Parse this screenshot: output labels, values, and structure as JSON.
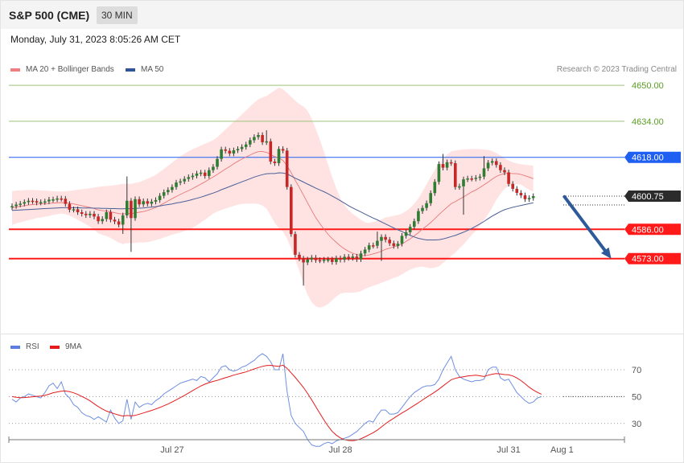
{
  "header": {
    "title": "S&P 500 (CME)",
    "timeframe": "30 MIN"
  },
  "date_text": "Monday, July 31, 2023 8:05:26 AM CET",
  "credit": "Research © 2023 Trading Central",
  "colors": {
    "bb_fill": "#ffd9d9",
    "ma20": "#e87878",
    "ma50": "#4a5f96",
    "bull": "#2e7d32",
    "bear": "#c62828",
    "resistance_green": "#9cc47a",
    "level_blue": "#1f5ff2",
    "level_red": "#ff1a1a",
    "rsi": "#6f8fe0",
    "rsi_ma": "#e51c1c",
    "arrow": "#2e5a9a"
  },
  "chart_data": [
    {
      "type": "candlestick",
      "legend": [
        {
          "name": "MA 20 + Bollinger Bands",
          "color": "#f08080"
        },
        {
          "name": "MA 50",
          "color": "#2f5597"
        }
      ],
      "ylim": [
        4551,
        4654
      ],
      "x_ticks": [
        {
          "label": "Jul 27",
          "i": 39
        },
        {
          "label": "Jul 28",
          "i": 80
        },
        {
          "label": "Jul 31",
          "i": 121
        },
        {
          "label": "Aug 1",
          "i": 134
        }
      ],
      "levels": [
        {
          "value": 4650.0,
          "label": "4650.00",
          "style": "green-text"
        },
        {
          "value": 4634.0,
          "label": "4634.00",
          "style": "green-text"
        },
        {
          "value": 4618.0,
          "label": "4618.00",
          "style": "blue-box"
        },
        {
          "value": 4600.75,
          "label": "4600.75",
          "style": "dark-box"
        },
        {
          "value": 4586.0,
          "label": "4586.00",
          "style": "red-box"
        },
        {
          "value": 4573.0,
          "label": "4573.00",
          "style": "red-box"
        }
      ],
      "close": [
        4596.3,
        4597,
        4597.4,
        4598.1,
        4598.7,
        4598.5,
        4597.9,
        4598.1,
        4598.4,
        4599.2,
        4599.3,
        4599.7,
        4599.6,
        4597.3,
        4594.7,
        4594.9,
        4593.6,
        4592.9,
        4592.3,
        4592.9,
        4591.7,
        4589.6,
        4590.6,
        4593.6,
        4590.3,
        4589.5,
        4588.1,
        4592.2,
        4598.7,
        4591,
        4599.4,
        4597.1,
        4598.5,
        4597.4,
        4598.3,
        4599,
        4600.9,
        4602.5,
        4603.5,
        4604.8,
        4606.8,
        4607.3,
        4608.4,
        4609.2,
        4609.8,
        4610.8,
        4611.2,
        4609.7,
        4612.3,
        4613.8,
        4617.3,
        4621.5,
        4620.9,
        4619.7,
        4621.1,
        4621.7,
        4622.6,
        4623.7,
        4625.6,
        4627,
        4627.9,
        4624.7,
        4625.1,
        4616.1,
        4615.4,
        4621.7,
        4621,
        4604.8,
        4583.9,
        4574.7,
        4573,
        4571.3,
        4572.6,
        4573.4,
        4572.3,
        4572.2,
        4572.5,
        4572.6,
        4571.5,
        4573.1,
        4572.5,
        4573.8,
        4573.3,
        4573.9,
        4572.7,
        4575.3,
        4577,
        4578.9,
        4578.7,
        4580.9,
        4582.6,
        4581.4,
        4579.8,
        4578.6,
        4579.6,
        4583.1,
        4584.7,
        4587.1,
        4589.6,
        4594.1,
        4595.5,
        4597.6,
        4602.1,
        4607.1,
        4615,
        4613.4,
        4615.8,
        4615.4,
        4604.8,
        4605.1,
        4608.2,
        4608.6,
        4608.5,
        4608.9,
        4609.4,
        4613.1,
        4615.6,
        4616.3,
        4614.6,
        4612.3,
        4611.3,
        4606.2,
        4604,
        4602.2,
        4601.1,
        4599.4,
        4599.9,
        4600.75
      ],
      "open": [
        4595.8,
        4596.3,
        4597,
        4597.4,
        4598.1,
        4598.7,
        4598.5,
        4597.9,
        4598.1,
        4598.4,
        4599.2,
        4599.3,
        4599.7,
        4599.6,
        4597.3,
        4594.7,
        4594.9,
        4593.6,
        4592.9,
        4592.3,
        4592.9,
        4591.7,
        4589.6,
        4590.6,
        4593.6,
        4590.3,
        4589.5,
        4588.1,
        4592.2,
        4598.7,
        4591,
        4599.4,
        4597.1,
        4598.5,
        4597.4,
        4598.3,
        4599,
        4600.9,
        4602.5,
        4603.5,
        4604.8,
        4606.8,
        4607.3,
        4608.4,
        4609.2,
        4609.8,
        4610.8,
        4611.2,
        4609.7,
        4612.3,
        4613.8,
        4617.3,
        4621.5,
        4620.9,
        4619.7,
        4621.1,
        4621.7,
        4622.6,
        4623.7,
        4625.6,
        4627,
        4627.9,
        4624.7,
        4625.1,
        4616.1,
        4615.4,
        4621.7,
        4621,
        4604.8,
        4583.9,
        4574.7,
        4573,
        4571.3,
        4572.6,
        4573.4,
        4572.3,
        4572.2,
        4572.5,
        4572.6,
        4571.5,
        4573.1,
        4572.5,
        4573.8,
        4573.3,
        4573.9,
        4572.7,
        4575.3,
        4577,
        4578.9,
        4578.7,
        4580.9,
        4582.6,
        4581.4,
        4579.8,
        4578.6,
        4579.6,
        4583.1,
        4584.7,
        4587.1,
        4589.6,
        4594.1,
        4595.5,
        4597.6,
        4602.1,
        4607.1,
        4615,
        4613.4,
        4615.8,
        4615.4,
        4604.8,
        4605.1,
        4608.2,
        4608.6,
        4608.5,
        4608.9,
        4609.4,
        4613.1,
        4615.6,
        4616.3,
        4614.6,
        4612.3,
        4611.3,
        4606.2,
        4604,
        4602.2,
        4601.1,
        4599.4,
        4599.9
      ],
      "wick_extremes": [
        {
          "i": 27,
          "value": 4584.0
        },
        {
          "i": 29,
          "value": 4576.0
        },
        {
          "i": 28,
          "value": 4609.5
        },
        {
          "i": 62,
          "value": 4630.0
        },
        {
          "i": 71,
          "value": 4561.0
        },
        {
          "i": 90,
          "value": 4572.0
        },
        {
          "i": 89,
          "value": 4585.0
        },
        {
          "i": 110,
          "value": 4592.5
        },
        {
          "i": 105,
          "value": 4619.5
        },
        {
          "i": 115,
          "value": 4618.5
        }
      ],
      "ma20": [
        4595.5,
        4595.9,
        4596.2,
        4596.5,
        4596.8,
        4597,
        4597.2,
        4597.3,
        4597.4,
        4597.5,
        4597.7,
        4597.8,
        4597.9,
        4597.8,
        4597.6,
        4597.3,
        4596.9,
        4596.5,
        4596.1,
        4595.7,
        4595.2,
        4594.6,
        4594.3,
        4594.1,
        4593.8,
        4593.4,
        4593,
        4592.8,
        4593.1,
        4593,
        4593.3,
        4593.6,
        4593.9,
        4594.4,
        4595,
        4595.7,
        4596.6,
        4597.6,
        4598.6,
        4599.6,
        4600.6,
        4601.5,
        4602.4,
        4603.2,
        4604.1,
        4605.1,
        4606.1,
        4607.1,
        4608.2,
        4609.3,
        4610.4,
        4611.6,
        4612.8,
        4613.9,
        4615.1,
        4616.2,
        4617.2,
        4618.1,
        4619,
        4619.9,
        4620.5,
        4620.6,
        4620.2,
        4619.3,
        4618.3,
        4617.8,
        4616.6,
        4614.3,
        4611.2,
        4607.8,
        4604.6,
        4601.2,
        4597.8,
        4594.4,
        4591.2,
        4588.5,
        4586.1,
        4583.8,
        4581.9,
        4580.2,
        4578.6,
        4577.3,
        4576.2,
        4575.4,
        4574.8,
        4574.4,
        4574.3,
        4574.6,
        4575.1,
        4575.6,
        4576.3,
        4577.1,
        4577.6,
        4578.2,
        4578.7,
        4579.5,
        4580.6,
        4581.8,
        4583.1,
        4584.5,
        4586.1,
        4587.5,
        4589,
        4590.7,
        4592.5,
        4594.2,
        4595.8,
        4597.4,
        4598.3,
        4599.4,
        4600.4,
        4601.5,
        4602.6,
        4603.5,
        4604.6,
        4605.8,
        4607,
        4608.3,
        4609.5,
        4610.3,
        4610.8,
        4610.9,
        4610.8,
        4610.7,
        4610.4,
        4609.8,
        4609.2,
        4608.5
      ],
      "bb_upper": [
        4603,
        4603.2,
        4603.3,
        4603.4,
        4603.5,
        4603.5,
        4603.4,
        4603.3,
        4603.2,
        4603.1,
        4603,
        4602.9,
        4602.8,
        4602.9,
        4603.1,
        4603.3,
        4603.6,
        4603.8,
        4604,
        4604.3,
        4604.6,
        4604.9,
        4605.1,
        4605.2,
        4605.4,
        4605.6,
        4605.9,
        4606.2,
        4606.3,
        4606.2,
        4606.6,
        4607,
        4607.7,
        4608.5,
        4609.3,
        4610.2,
        4611.5,
        4612.8,
        4614.2,
        4615.6,
        4617.1,
        4618.4,
        4619.6,
        4620.6,
        4621.6,
        4622.4,
        4623.2,
        4624,
        4624.8,
        4625.6,
        4626.9,
        4628.6,
        4630.4,
        4632,
        4633.8,
        4635.4,
        4637.1,
        4638.8,
        4640.6,
        4642.3,
        4643.8,
        4644.6,
        4645.2,
        4646.5,
        4647.7,
        4649,
        4648.2,
        4646.7,
        4644.9,
        4643.2,
        4641.6,
        4640.6,
        4638.7,
        4635.2,
        4630.6,
        4625.8,
        4620.5,
        4614.8,
        4609.3,
        4604.3,
        4599.8,
        4596.8,
        4594.5,
        4592.9,
        4591.6,
        4590.3,
        4589.1,
        4588.9,
        4589.3,
        4589.7,
        4590.4,
        4591.3,
        4591.6,
        4592,
        4592.4,
        4593,
        4594.1,
        4595.5,
        4597.4,
        4599.8,
        4602.8,
        4606,
        4609.3,
        4612.4,
        4615.4,
        4617.4,
        4619.2,
        4620.6,
        4621,
        4621.3,
        4621.5,
        4621.6,
        4621.7,
        4621.7,
        4621.6,
        4621.5,
        4621.3,
        4620.8,
        4619.9,
        4618.8,
        4617.6,
        4616.6,
        4615.8,
        4615.3,
        4614.9,
        4614.7,
        4614.5,
        4614.3
      ],
      "bb_lower": [
        4588,
        4588.6,
        4589.1,
        4589.6,
        4590.1,
        4590.5,
        4591,
        4591.3,
        4591.6,
        4591.9,
        4592.4,
        4592.7,
        4593,
        4592.7,
        4592.1,
        4591.3,
        4590.2,
        4589.2,
        4588.2,
        4587.1,
        4585.8,
        4584.3,
        4583.5,
        4583,
        4582.2,
        4581.2,
        4580.1,
        4579.4,
        4579.9,
        4579.8,
        4580,
        4580.2,
        4580.1,
        4580.3,
        4580.7,
        4581.2,
        4581.7,
        4582.4,
        4583,
        4583.6,
        4584.1,
        4584.6,
        4585.2,
        4585.8,
        4586.6,
        4587.8,
        4589,
        4590.2,
        4591.6,
        4593,
        4593.9,
        4594.6,
        4595.2,
        4595.8,
        4596.4,
        4597,
        4597.3,
        4597.4,
        4597.4,
        4597.5,
        4597.2,
        4596.6,
        4595.2,
        4592.1,
        4588.9,
        4586.6,
        4585,
        4581.9,
        4577.5,
        4572.4,
        4567.6,
        4561.8,
        4556.9,
        4553.6,
        4551.8,
        4551.2,
        4551.7,
        4552.8,
        4554.5,
        4556.1,
        4557.4,
        4557.8,
        4557.9,
        4557.9,
        4558,
        4558.5,
        4559.5,
        4560.3,
        4560.9,
        4561.5,
        4562.2,
        4562.9,
        4563.6,
        4564.4,
        4565,
        4566,
        4567.1,
        4568.1,
        4568.8,
        4569.2,
        4569.4,
        4569,
        4568.7,
        4569,
        4569.6,
        4571,
        4572.4,
        4574.2,
        4575.6,
        4577.5,
        4579.3,
        4581.4,
        4583.5,
        4585.3,
        4587.6,
        4590.1,
        4592.7,
        4595.8,
        4599.1,
        4601.8,
        4604,
        4605.2,
        4605.8,
        4606,
        4605.9,
        4604.7,
        4603.5,
        4602.7
      ],
      "ma50": [
        4594.4,
        4594.5,
        4594.6,
        4594.7,
        4594.8,
        4594.9,
        4595,
        4595.1,
        4595.2,
        4595.3,
        4595.4,
        4595.5,
        4595.6,
        4595.6,
        4595.6,
        4595.6,
        4595.6,
        4595.5,
        4595.5,
        4595.5,
        4595.4,
        4595.4,
        4595.3,
        4595.3,
        4595.2,
        4595.2,
        4595.1,
        4595.1,
        4595.2,
        4595.1,
        4595.3,
        4595.4,
        4595.5,
        4595.7,
        4595.9,
        4596.1,
        4596.4,
        4596.7,
        4597,
        4597.3,
        4597.7,
        4598,
        4598.4,
        4598.8,
        4599.3,
        4599.8,
        4600.3,
        4600.9,
        4601.5,
        4602.1,
        4602.8,
        4603.6,
        4604.3,
        4605,
        4605.7,
        4606.4,
        4607.1,
        4607.8,
        4608.5,
        4609.2,
        4609.8,
        4610.3,
        4610.7,
        4610.8,
        4610.8,
        4611.1,
        4611,
        4610.6,
        4609.7,
        4608.7,
        4607.9,
        4607,
        4606.1,
        4605.2,
        4604.3,
        4603.5,
        4602.7,
        4601.8,
        4600.8,
        4599.8,
        4598.7,
        4597.6,
        4596.5,
        4595.5,
        4594.6,
        4593.7,
        4592.8,
        4591.9,
        4591,
        4590.2,
        4589.3,
        4588.4,
        4587.5,
        4586.6,
        4585.8,
        4585,
        4584.1,
        4583.3,
        4582.6,
        4582,
        4581.6,
        4581.3,
        4581.3,
        4581.3,
        4581.4,
        4581.7,
        4582.2,
        4582.8,
        4583.3,
        4584,
        4584.7,
        4585.5,
        4586.4,
        4587.4,
        4588.4,
        4589.5,
        4590.7,
        4591.9,
        4592.9,
        4593.9,
        4594.7,
        4595.3,
        4595.8,
        4596.2,
        4596.6,
        4597,
        4597.4,
        4597.8
      ],
      "forecast_arrow": {
        "from": {
          "i": 134,
          "value": 4600.5
        },
        "to": {
          "i": 146,
          "value": 4573.0
        }
      }
    },
    {
      "type": "line",
      "legend": [
        {
          "name": "RSI",
          "color": "#5b7fe0"
        },
        {
          "name": "9MA",
          "color": "#e51c1c"
        }
      ],
      "ylim": [
        12,
        90
      ],
      "y_ticks": [
        {
          "value": 70,
          "label": "70"
        },
        {
          "value": 50,
          "label": "50"
        },
        {
          "value": 30,
          "label": "30"
        }
      ],
      "rsi": [
        48,
        46,
        49,
        50,
        52,
        51,
        50,
        49,
        53,
        58,
        60,
        56,
        61,
        52,
        49,
        44,
        42,
        38,
        36,
        35,
        33,
        35,
        33,
        31,
        40,
        34,
        30,
        32,
        48,
        33,
        46,
        42,
        44,
        45,
        44,
        47,
        49,
        52,
        54,
        56,
        58,
        60,
        61,
        62,
        63,
        62,
        65,
        64,
        61,
        64,
        67,
        72,
        73,
        70,
        69,
        70,
        72,
        73,
        75,
        77,
        80,
        82,
        80,
        76,
        70,
        70,
        82,
        54,
        36,
        30,
        27,
        24,
        18,
        14,
        13,
        13,
        15,
        16,
        15,
        17,
        18,
        19,
        20,
        22,
        24,
        27,
        30,
        32,
        31,
        36,
        40,
        40,
        37,
        37,
        38,
        42,
        46,
        50,
        53,
        55,
        57,
        58,
        58,
        59,
        63,
        70,
        75,
        80,
        70,
        65,
        63,
        62,
        61,
        62,
        62,
        63,
        70,
        72,
        72,
        64,
        62,
        63,
        58,
        53,
        50,
        47,
        45,
        46,
        49,
        50
      ],
      "rsi_ma": [
        50,
        49.5,
        49.2,
        49.3,
        49.6,
        49.9,
        50.2,
        50.4,
        50.9,
        51.8,
        52.9,
        53.5,
        54.1,
        54.2,
        53.7,
        52.8,
        51.6,
        50.1,
        48.6,
        46.8,
        44.7,
        42.6,
        40.8,
        39.2,
        38.2,
        37.2,
        36.2,
        35.5,
        35.9,
        35.6,
        36,
        36.9,
        37.8,
        38.8,
        39.7,
        40.8,
        41.9,
        43.2,
        44.5,
        46,
        47.6,
        49.2,
        50.9,
        52.7,
        54.5,
        56.2,
        57.9,
        59.3,
        60.4,
        61.3,
        62.1,
        63.1,
        64.1,
        65,
        66,
        66.8,
        67.6,
        68.4,
        69.5,
        70.6,
        71.6,
        72.5,
        73.1,
        73.3,
        72.9,
        72.5,
        73.4,
        71.1,
        67.7,
        64.3,
        60.6,
        56.8,
        52.4,
        47.6,
        42.5,
        37.5,
        32.6,
        28,
        24.1,
        21.3,
        19.2,
        17.9,
        17.3,
        17.2,
        17.6,
        18.6,
        20,
        21.6,
        23.1,
        25,
        27.4,
        29.8,
        31.9,
        33.9,
        35.9,
        37.8,
        39.6,
        41.5,
        43.5,
        45.4,
        47.5,
        49.5,
        51.4,
        53.4,
        55.5,
        57.9,
        60.2,
        62.6,
        63.6,
        64.3,
        64.8,
        65.3,
        65.7,
        65.9,
        65.5,
        65,
        65.9,
        66.7,
        67.2,
        66.8,
        66.4,
        66.2,
        65.4,
        63.9,
        61.9,
        59.6,
        57,
        54.9,
        53.2,
        51.8
      ]
    }
  ]
}
